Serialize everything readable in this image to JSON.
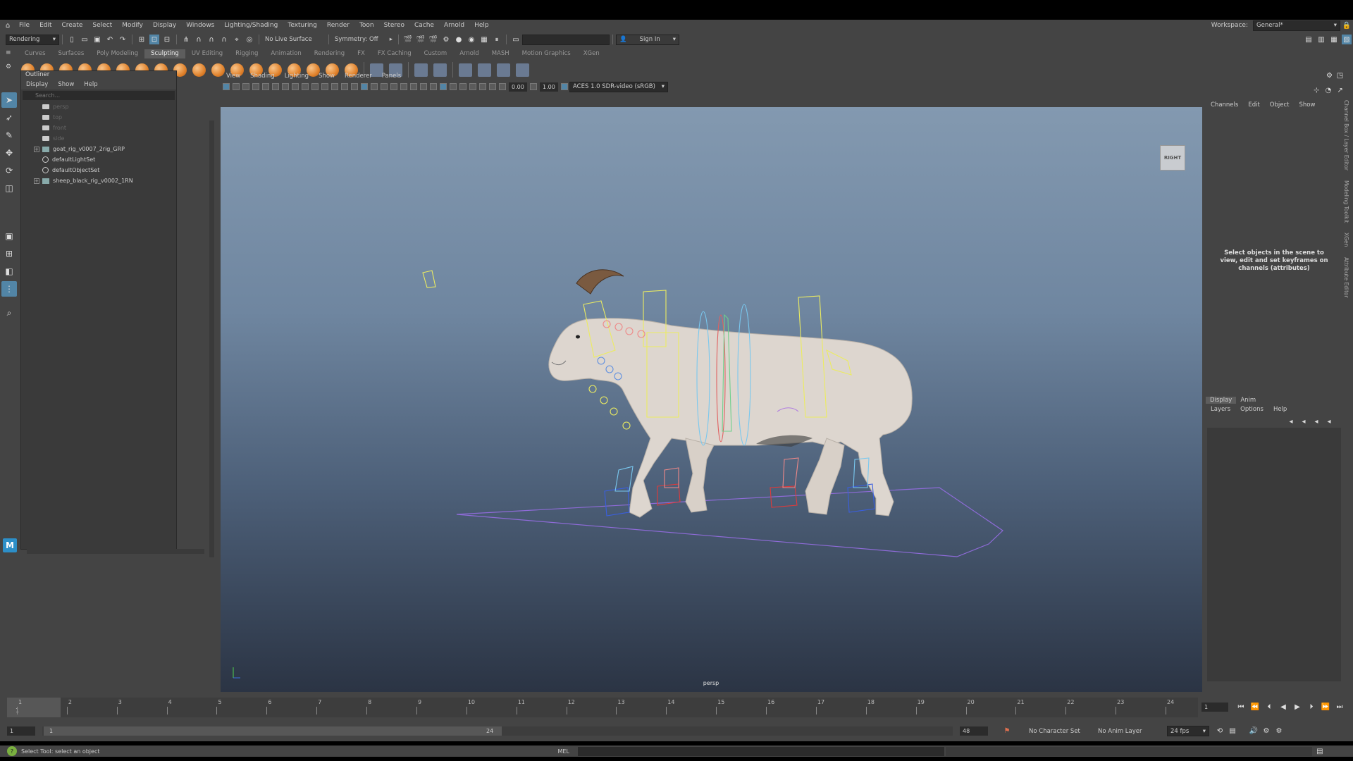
{
  "menubar": {
    "items": [
      "File",
      "Edit",
      "Create",
      "Select",
      "Modify",
      "Display",
      "Windows",
      "Lighting/Shading",
      "Texturing",
      "Render",
      "Toon",
      "Stereo",
      "Cache",
      "Arnold",
      "Help"
    ],
    "workspace_label": "Workspace:",
    "workspace_value": "General*"
  },
  "statusline": {
    "menuset": "Rendering",
    "live_surface": "No Live Surface",
    "symmetry": "Symmetry: Off",
    "sign_in": "Sign In"
  },
  "shelf": {
    "tabs": [
      "Curves",
      "Surfaces",
      "Poly Modeling",
      "Sculpting",
      "UV Editing",
      "Rigging",
      "Animation",
      "Rendering",
      "FX",
      "FX Caching",
      "Custom",
      "Arnold",
      "MASH",
      "Motion Graphics",
      "XGen"
    ],
    "active_tab": "Sculpting"
  },
  "outliner": {
    "title": "Outliner",
    "menus": [
      "Display",
      "Show",
      "Help"
    ],
    "search_placeholder": "Search...",
    "items": [
      {
        "label": "persp",
        "type": "camera",
        "dim": true
      },
      {
        "label": "top",
        "type": "camera",
        "dim": true
      },
      {
        "label": "front",
        "type": "camera",
        "dim": true
      },
      {
        "label": "side",
        "type": "camera",
        "dim": true
      },
      {
        "label": "goat_rig_v0007_2rig_GRP",
        "type": "group",
        "dim": false
      },
      {
        "label": "defaultLightSet",
        "type": "set",
        "dim": false
      },
      {
        "label": "defaultObjectSet",
        "type": "set",
        "dim": false
      },
      {
        "label": "sheep_black_rig_v0002_1RN",
        "type": "ref",
        "dim": false
      }
    ]
  },
  "viewport": {
    "menus": [
      "View",
      "Shading",
      "Lighting",
      "Show",
      "Renderer",
      "Panels"
    ],
    "exposure": "0.00",
    "gamma": "1.00",
    "colorspace": "ACES 1.0 SDR-video (sRGB)",
    "camera_label": "persp",
    "viewcube_label": "RIGHT"
  },
  "channelbox": {
    "menus": [
      "Channels",
      "Edit",
      "Object",
      "Show"
    ],
    "message": "Select objects in the scene to view, edit and set keyframes on channels (attributes)"
  },
  "layereditor": {
    "tabs": [
      "Display",
      "Anim"
    ],
    "menus": [
      "Layers",
      "Options",
      "Help"
    ]
  },
  "sidetabs": [
    "Channel Box / Layer Editor",
    "Modeling Toolkit",
    "XGen",
    "Attribute Editor"
  ],
  "timeline": {
    "ticks": [
      "1",
      "2",
      "3",
      "4",
      "5",
      "6",
      "7",
      "8",
      "9",
      "10",
      "11",
      "12",
      "13",
      "14",
      "15",
      "16",
      "17",
      "18",
      "19",
      "20",
      "21",
      "22",
      "23",
      "24"
    ],
    "current_frame": "1",
    "frame_field": "1"
  },
  "range": {
    "start": "1",
    "range_start": "1",
    "range_end": "24",
    "end": "48",
    "character_set": "No Character Set",
    "anim_layer": "No Anim Layer",
    "fps": "24 fps"
  },
  "helpline": {
    "message": "Select Tool: select an object",
    "mel_label": "MEL"
  }
}
